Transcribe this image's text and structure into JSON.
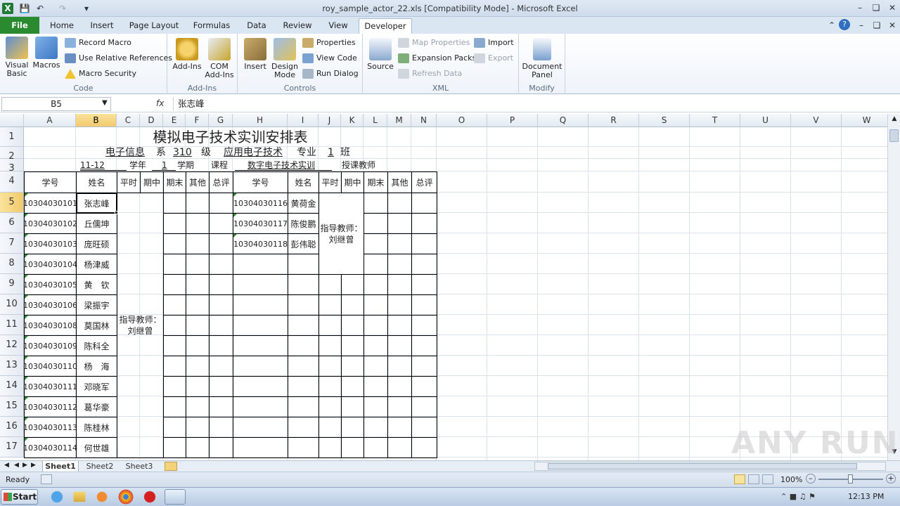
{
  "window": {
    "title": "roy_sample_actor_22.xls  [Compatibility Mode]  -  Microsoft Excel",
    "app_icon": "X"
  },
  "quick_access": {
    "save_icon": "save-icon",
    "undo_icon": "undo-icon",
    "redo_icon": "redo-icon",
    "customize_icon": "customize-icon"
  },
  "tabs": [
    "File",
    "Home",
    "Insert",
    "Page Layout",
    "Formulas",
    "Data",
    "Review",
    "View",
    "Developer"
  ],
  "active_tab": "Developer",
  "ribbon": {
    "code": {
      "label": "Code",
      "visual_basic": "Visual Basic",
      "macros": "Macros",
      "record_macro": "Record Macro",
      "relative_refs": "Use Relative References",
      "macro_security": "Macro Security"
    },
    "addins": {
      "label": "Add-Ins",
      "addins": "Add-Ins",
      "com_addins": "COM Add-Ins"
    },
    "controls": {
      "label": "Controls",
      "insert": "Insert",
      "design_mode": "Design Mode",
      "properties": "Properties",
      "view_code": "View Code",
      "run_dialog": "Run Dialog"
    },
    "xml": {
      "label": "XML",
      "source": "Source",
      "map_properties": "Map Properties",
      "expansion_packs": "Expansion Packs",
      "refresh_data": "Refresh Data",
      "import": "Import",
      "export": "Export"
    },
    "modify": {
      "label": "Modify",
      "document_panel": "Document Panel"
    }
  },
  "formula_bar": {
    "name_box": "B5",
    "fx": "fx",
    "value": "张志峰"
  },
  "columns": [
    "A",
    "B",
    "C",
    "D",
    "E",
    "F",
    "G",
    "H",
    "I",
    "J",
    "K",
    "L",
    "M",
    "N",
    "O",
    "P",
    "Q",
    "R",
    "S",
    "T",
    "U",
    "V",
    "W"
  ],
  "rows": [
    "1",
    "2",
    "3",
    "4",
    "5",
    "6",
    "7",
    "8",
    "9",
    "10",
    "11",
    "12",
    "13",
    "14",
    "15",
    "16",
    "17"
  ],
  "sheet": {
    "title": "模拟电子技术实训安排表",
    "row2": {
      "dept": "电子信息",
      "dept_suffix": "系",
      "grade": "310",
      "grade_suffix": "级",
      "major": "应用电子技术",
      "major_suffix": "专业",
      "cls": "1",
      "cls_suffix": "班"
    },
    "row3": {
      "year": "11-12",
      "year_suffix": "学年",
      "term": "1",
      "term_suffix": "学期",
      "course_label": "课程",
      "course": "数字电子技术实训",
      "teacher_label": "授课教师"
    },
    "headers": [
      "学号",
      "姓名",
      "平时",
      "期中",
      "期末",
      "其他",
      "总评",
      "学号",
      "姓名",
      "平时",
      "期中",
      "期末",
      "其他",
      "总评"
    ],
    "left_students": [
      {
        "id": "10304030101",
        "name": "张志峰"
      },
      {
        "id": "10304030102",
        "name": "丘儒坤"
      },
      {
        "id": "10304030103",
        "name": "庞旺硕"
      },
      {
        "id": "10304030104",
        "name": "杨津威"
      },
      {
        "id": "10304030105",
        "name": "黄　钦"
      },
      {
        "id": "10304030106",
        "name": "梁振宇"
      },
      {
        "id": "10304030108",
        "name": "莫国林"
      },
      {
        "id": "10304030109",
        "name": "陈科全"
      },
      {
        "id": "10304030110",
        "name": "杨　海"
      },
      {
        "id": "10304030111",
        "name": "邓晓军"
      },
      {
        "id": "10304030112",
        "name": "葛华豪"
      },
      {
        "id": "10304030113",
        "name": "陈桂林"
      },
      {
        "id": "10304030114",
        "name": "何世雄"
      }
    ],
    "right_students": [
      {
        "id": "10304030116",
        "name": "黄荷金"
      },
      {
        "id": "10304030117",
        "name": "陈俊鹏"
      },
      {
        "id": "10304030118",
        "name": "彭伟聪"
      }
    ],
    "advisor_left": "指导教师：\n刘继曾",
    "advisor_right": "指导教师：\n刘继曾"
  },
  "sheet_tabs": [
    "Sheet1",
    "Sheet2",
    "Sheet3"
  ],
  "active_sheet": "Sheet1",
  "status": {
    "ready": "Ready",
    "zoom": "100%"
  },
  "taskbar": {
    "start": "Start",
    "time": "12:13 PM"
  },
  "watermark": "ANY RUN"
}
